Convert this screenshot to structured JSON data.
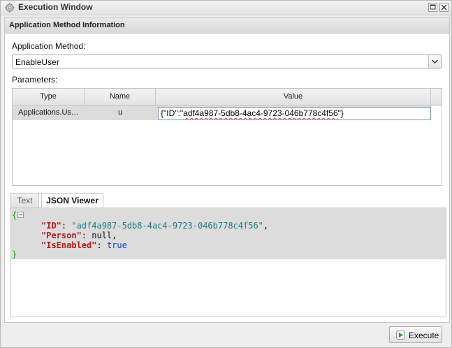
{
  "window": {
    "title": "Execution Window"
  },
  "panel": {
    "title": "Application Method Information"
  },
  "method": {
    "label": "Application Method:",
    "selected": "EnableUser"
  },
  "parameters": {
    "label": "Parameters:",
    "columns": [
      "Type",
      "Name",
      "Value"
    ],
    "rows": [
      {
        "type": "Applications.Us…",
        "name": "u",
        "value_prefix": "{\"ID\":\"",
        "value_id": "adf4a987-5db8-4ac4-9723-046b778c4f56",
        "value_suffix": "\"}"
      }
    ]
  },
  "tabs": [
    {
      "label": "Text",
      "active": false
    },
    {
      "label": "JSON Viewer",
      "active": true
    }
  ],
  "json_viewer": {
    "open_brace": "{",
    "close_brace": "}",
    "lines": [
      {
        "key": "\"ID\"",
        "sep": ": ",
        "value": "\"adf4a987-5db8-4ac4-9723-046b778c4f56\"",
        "value_kind": "string",
        "trail": ","
      },
      {
        "key": "\"Person\"",
        "sep": ": ",
        "value": "null",
        "value_kind": "null",
        "trail": ","
      },
      {
        "key": "\"IsEnabled\"",
        "sep": ": ",
        "value": "true",
        "value_kind": "bool",
        "trail": ""
      }
    ]
  },
  "actions": {
    "execute_label": "Execute"
  },
  "colors": {
    "json_key": "#b71c1c",
    "json_string": "#1a7a8a",
    "json_bool": "#1a3fc9",
    "json_brace": "#1e9e1e",
    "execute_icon": "#2e9a2e"
  }
}
